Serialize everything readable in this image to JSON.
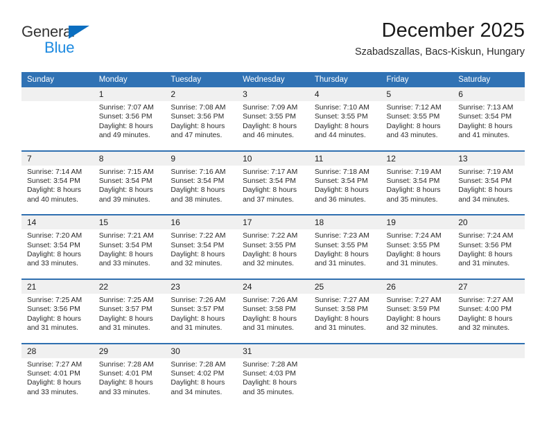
{
  "brand": {
    "name_top": "General",
    "name_bottom": "Blue",
    "triangle_color": "#0a6ec0",
    "text_color": "#1b89e0"
  },
  "header": {
    "title": "December 2025",
    "subtitle": "Szabadszallas, Bacs-Kiskun, Hungary"
  },
  "theme": {
    "header_blue": "#3072b4",
    "separator_blue": "#2f6fb0",
    "daynum_band": "#f0f0f0",
    "page_bg": "#ffffff"
  },
  "calendar": {
    "weekdays": [
      "Sunday",
      "Monday",
      "Tuesday",
      "Wednesday",
      "Thursday",
      "Friday",
      "Saturday"
    ],
    "weeks": [
      [
        {
          "day": "",
          "lines": []
        },
        {
          "day": "1",
          "lines": [
            "Sunrise: 7:07 AM",
            "Sunset: 3:56 PM",
            "Daylight: 8 hours",
            "and 49 minutes."
          ]
        },
        {
          "day": "2",
          "lines": [
            "Sunrise: 7:08 AM",
            "Sunset: 3:56 PM",
            "Daylight: 8 hours",
            "and 47 minutes."
          ]
        },
        {
          "day": "3",
          "lines": [
            "Sunrise: 7:09 AM",
            "Sunset: 3:55 PM",
            "Daylight: 8 hours",
            "and 46 minutes."
          ]
        },
        {
          "day": "4",
          "lines": [
            "Sunrise: 7:10 AM",
            "Sunset: 3:55 PM",
            "Daylight: 8 hours",
            "and 44 minutes."
          ]
        },
        {
          "day": "5",
          "lines": [
            "Sunrise: 7:12 AM",
            "Sunset: 3:55 PM",
            "Daylight: 8 hours",
            "and 43 minutes."
          ]
        },
        {
          "day": "6",
          "lines": [
            "Sunrise: 7:13 AM",
            "Sunset: 3:54 PM",
            "Daylight: 8 hours",
            "and 41 minutes."
          ]
        }
      ],
      [
        {
          "day": "7",
          "lines": [
            "Sunrise: 7:14 AM",
            "Sunset: 3:54 PM",
            "Daylight: 8 hours",
            "and 40 minutes."
          ]
        },
        {
          "day": "8",
          "lines": [
            "Sunrise: 7:15 AM",
            "Sunset: 3:54 PM",
            "Daylight: 8 hours",
            "and 39 minutes."
          ]
        },
        {
          "day": "9",
          "lines": [
            "Sunrise: 7:16 AM",
            "Sunset: 3:54 PM",
            "Daylight: 8 hours",
            "and 38 minutes."
          ]
        },
        {
          "day": "10",
          "lines": [
            "Sunrise: 7:17 AM",
            "Sunset: 3:54 PM",
            "Daylight: 8 hours",
            "and 37 minutes."
          ]
        },
        {
          "day": "11",
          "lines": [
            "Sunrise: 7:18 AM",
            "Sunset: 3:54 PM",
            "Daylight: 8 hours",
            "and 36 minutes."
          ]
        },
        {
          "day": "12",
          "lines": [
            "Sunrise: 7:19 AM",
            "Sunset: 3:54 PM",
            "Daylight: 8 hours",
            "and 35 minutes."
          ]
        },
        {
          "day": "13",
          "lines": [
            "Sunrise: 7:19 AM",
            "Sunset: 3:54 PM",
            "Daylight: 8 hours",
            "and 34 minutes."
          ]
        }
      ],
      [
        {
          "day": "14",
          "lines": [
            "Sunrise: 7:20 AM",
            "Sunset: 3:54 PM",
            "Daylight: 8 hours",
            "and 33 minutes."
          ]
        },
        {
          "day": "15",
          "lines": [
            "Sunrise: 7:21 AM",
            "Sunset: 3:54 PM",
            "Daylight: 8 hours",
            "and 33 minutes."
          ]
        },
        {
          "day": "16",
          "lines": [
            "Sunrise: 7:22 AM",
            "Sunset: 3:54 PM",
            "Daylight: 8 hours",
            "and 32 minutes."
          ]
        },
        {
          "day": "17",
          "lines": [
            "Sunrise: 7:22 AM",
            "Sunset: 3:55 PM",
            "Daylight: 8 hours",
            "and 32 minutes."
          ]
        },
        {
          "day": "18",
          "lines": [
            "Sunrise: 7:23 AM",
            "Sunset: 3:55 PM",
            "Daylight: 8 hours",
            "and 31 minutes."
          ]
        },
        {
          "day": "19",
          "lines": [
            "Sunrise: 7:24 AM",
            "Sunset: 3:55 PM",
            "Daylight: 8 hours",
            "and 31 minutes."
          ]
        },
        {
          "day": "20",
          "lines": [
            "Sunrise: 7:24 AM",
            "Sunset: 3:56 PM",
            "Daylight: 8 hours",
            "and 31 minutes."
          ]
        }
      ],
      [
        {
          "day": "21",
          "lines": [
            "Sunrise: 7:25 AM",
            "Sunset: 3:56 PM",
            "Daylight: 8 hours",
            "and 31 minutes."
          ]
        },
        {
          "day": "22",
          "lines": [
            "Sunrise: 7:25 AM",
            "Sunset: 3:57 PM",
            "Daylight: 8 hours",
            "and 31 minutes."
          ]
        },
        {
          "day": "23",
          "lines": [
            "Sunrise: 7:26 AM",
            "Sunset: 3:57 PM",
            "Daylight: 8 hours",
            "and 31 minutes."
          ]
        },
        {
          "day": "24",
          "lines": [
            "Sunrise: 7:26 AM",
            "Sunset: 3:58 PM",
            "Daylight: 8 hours",
            "and 31 minutes."
          ]
        },
        {
          "day": "25",
          "lines": [
            "Sunrise: 7:27 AM",
            "Sunset: 3:58 PM",
            "Daylight: 8 hours",
            "and 31 minutes."
          ]
        },
        {
          "day": "26",
          "lines": [
            "Sunrise: 7:27 AM",
            "Sunset: 3:59 PM",
            "Daylight: 8 hours",
            "and 32 minutes."
          ]
        },
        {
          "day": "27",
          "lines": [
            "Sunrise: 7:27 AM",
            "Sunset: 4:00 PM",
            "Daylight: 8 hours",
            "and 32 minutes."
          ]
        }
      ],
      [
        {
          "day": "28",
          "lines": [
            "Sunrise: 7:27 AM",
            "Sunset: 4:01 PM",
            "Daylight: 8 hours",
            "and 33 minutes."
          ]
        },
        {
          "day": "29",
          "lines": [
            "Sunrise: 7:28 AM",
            "Sunset: 4:01 PM",
            "Daylight: 8 hours",
            "and 33 minutes."
          ]
        },
        {
          "day": "30",
          "lines": [
            "Sunrise: 7:28 AM",
            "Sunset: 4:02 PM",
            "Daylight: 8 hours",
            "and 34 minutes."
          ]
        },
        {
          "day": "31",
          "lines": [
            "Sunrise: 7:28 AM",
            "Sunset: 4:03 PM",
            "Daylight: 8 hours",
            "and 35 minutes."
          ]
        },
        {
          "day": "",
          "lines": []
        },
        {
          "day": "",
          "lines": []
        },
        {
          "day": "",
          "lines": []
        }
      ]
    ]
  }
}
